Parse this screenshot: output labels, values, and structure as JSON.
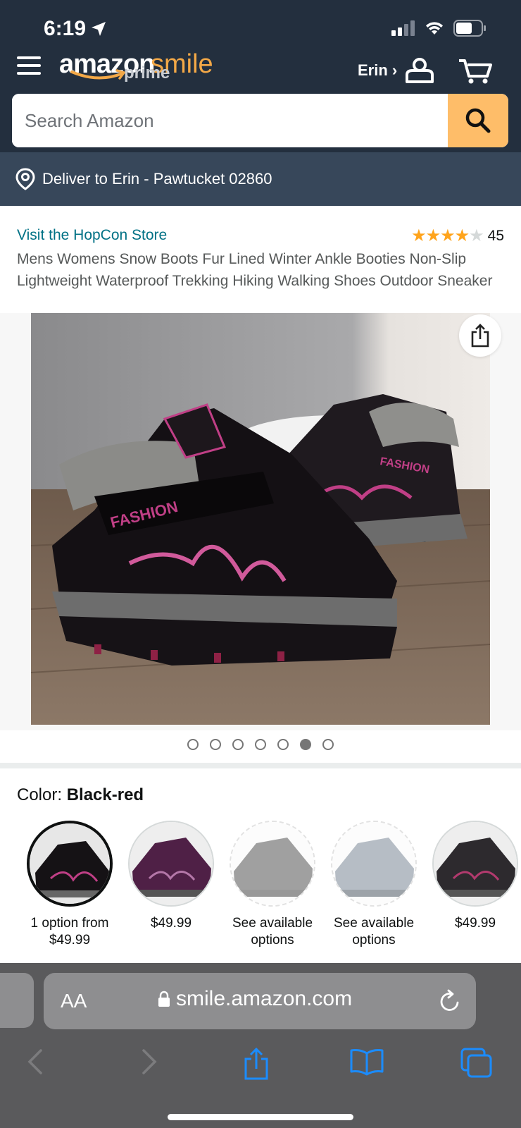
{
  "status": {
    "time": "6:19"
  },
  "header": {
    "logo_word": "amazon",
    "logo_smile": "smile",
    "logo_prime": "prime",
    "account_label": "Erin ›"
  },
  "search": {
    "placeholder": "Search Amazon"
  },
  "deliver": {
    "text": "Deliver to Erin - Pawtucket 02860"
  },
  "product": {
    "store_link": "Visit the HopCon Store",
    "rating_count": "45",
    "rating_value": 4,
    "title": "Mens Womens Snow Boots Fur Lined Winter Ankle Booties Non-Slip Lightweight Waterproof Trekking Hiking Walking Shoes Outdoor Sneaker",
    "image_count": 7,
    "active_image_index": 5,
    "color_label": "Color: ",
    "color_value": "Black-red",
    "swatches": [
      {
        "price": "1 option from $49.99",
        "line1": "1 option from",
        "line2": "$49.99",
        "state": "selected"
      },
      {
        "price": "$49.99",
        "line1": "$49.99",
        "line2": "",
        "state": "available"
      },
      {
        "price": "See available options",
        "line1": "See available",
        "line2": "options",
        "state": "unavailable"
      },
      {
        "price": "See available options",
        "line1": "See available",
        "line2": "options",
        "state": "unavailable"
      },
      {
        "price": "$49.99",
        "line1": "$49.99",
        "line2": "",
        "state": "available"
      }
    ]
  },
  "safari": {
    "aa_label": "AA",
    "url": "smile.amazon.com"
  },
  "colors": {
    "header_bg": "#232f3e",
    "deliver_bg": "#37475a",
    "search_button": "#febd69",
    "link": "#007185",
    "star": "#ffa41c"
  }
}
